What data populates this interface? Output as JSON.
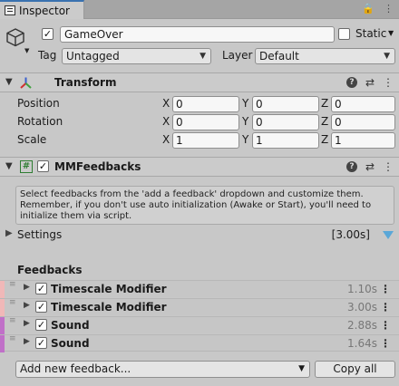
{
  "window": {
    "tab_label": "Inspector",
    "lock_icon": "lock-icon",
    "menu_icon": "kebab-menu-icon"
  },
  "gameobject": {
    "active": true,
    "name": "GameOver",
    "static_label": "Static",
    "static_checked": false,
    "tag_label": "Tag",
    "tag_value": "Untagged",
    "layer_label": "Layer",
    "layer_value": "Default"
  },
  "transform": {
    "title": "Transform",
    "rows": [
      {
        "label": "Position",
        "x": "0",
        "y": "0",
        "z": "0"
      },
      {
        "label": "Rotation",
        "x": "0",
        "y": "0",
        "z": "0"
      },
      {
        "label": "Scale",
        "x": "1",
        "y": "1",
        "z": "1"
      }
    ],
    "axis_labels": {
      "x": "X",
      "y": "Y",
      "z": "Z"
    }
  },
  "mmfeedbacks": {
    "enabled": true,
    "title": "MMFeedbacks",
    "help_text": "Select feedbacks from the 'add a feedback' dropdown and customize them. Remember, if you don't use auto initialization (Awake or Start), you'll need to initialize them via script.",
    "settings_label": "Settings",
    "total_duration": "[3.00s]",
    "feedbacks_label": "Feedbacks",
    "feedbacks": [
      {
        "name": "Timescale Modifier",
        "time": "1.10s",
        "color": "#f0b8b8",
        "enabled": true
      },
      {
        "name": "Timescale Modifier",
        "time": "3.00s",
        "color": "#f0b8b8",
        "enabled": true
      },
      {
        "name": "Sound",
        "time": "2.88s",
        "color": "#c070c8",
        "enabled": true
      },
      {
        "name": "Sound",
        "time": "1.64s",
        "color": "#c070c8",
        "enabled": true
      }
    ],
    "add_dropdown": "Add new feedback...",
    "copy_all_label": "Copy all"
  },
  "colors": {
    "accent_tab": "#3a72b0",
    "timing_arrow": "#5aa7d8"
  }
}
